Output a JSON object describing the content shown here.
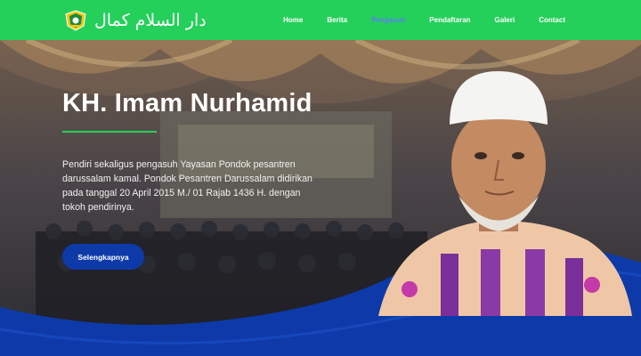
{
  "navbar": {
    "brand_text": "دار السلام كمال",
    "logo_icon": "pesantren-emblem-icon",
    "links": [
      {
        "label": "Home",
        "active": false
      },
      {
        "label": "Berita",
        "active": false
      },
      {
        "label": "Pengasuh",
        "active": true
      },
      {
        "label": "Pendaftaran",
        "active": false
      },
      {
        "label": "Galeri",
        "active": false
      },
      {
        "label": "Contact",
        "active": false
      }
    ]
  },
  "hero": {
    "title": "KH. Imam Nurhamid",
    "description": "Pendiri sekaligus pengasuh Yayasan Pondok pesantren darussalam kamal. Pondok Pesantren Darussalam didirikan pada tanggal 20 April 2015 M./ 01 Rajab 1436 H. dengan tokoh pendirinya.",
    "button_label": "Selengkapnya"
  },
  "colors": {
    "navbar": "#24d05a",
    "accent_rule": "#24d05a",
    "button": "#0d3aa8",
    "wave": "#0d3aa8",
    "active_link": "#5c7cfa"
  }
}
